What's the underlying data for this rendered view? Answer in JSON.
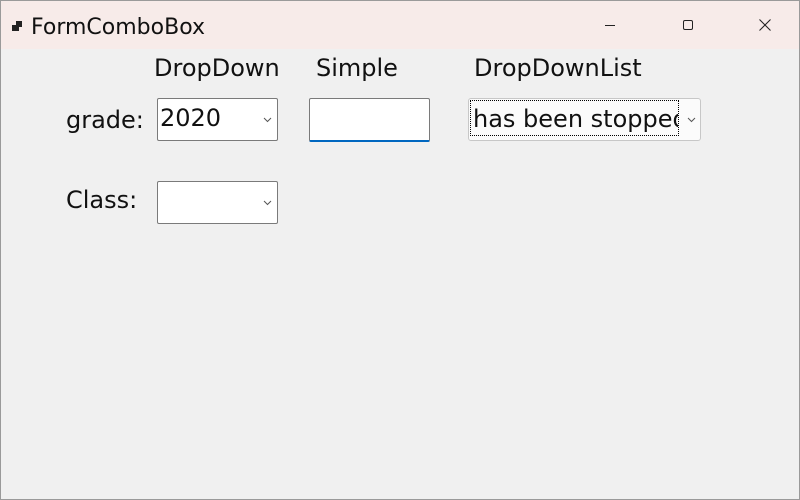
{
  "window": {
    "title": "FormComboBox",
    "icons": {
      "app": "app-icon",
      "minimize": "minimize-icon",
      "maximize": "maximize-icon",
      "close": "close-icon"
    }
  },
  "headers": {
    "dropdown": "DropDown",
    "simple": "Simple",
    "dropdownlist": "DropDownList"
  },
  "rows": {
    "grade": {
      "label": "grade:",
      "dropdown_value": "2020",
      "simple_value": "",
      "dropdownlist_value": "has been stopped"
    },
    "class": {
      "label": "Class:",
      "dropdown_value": ""
    }
  },
  "colors": {
    "titlebar": "#f7ebe9",
    "form_background": "#f0f0f0",
    "focus_accent": "#0067c0"
  }
}
